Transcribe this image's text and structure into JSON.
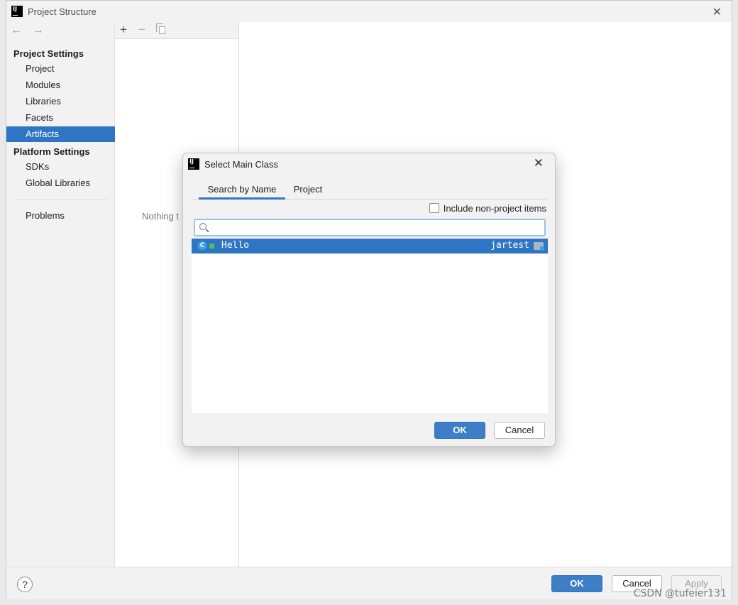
{
  "window": {
    "title": "Project Structure",
    "close_glyph": "✕"
  },
  "nav": {
    "back_glyph": "←",
    "forward_glyph": "→",
    "project_settings_heading": "Project Settings",
    "project_settings_items": [
      "Project",
      "Modules",
      "Libraries",
      "Facets",
      "Artifacts"
    ],
    "platform_settings_heading": "Platform Settings",
    "platform_settings_items": [
      "SDKs",
      "Global Libraries"
    ],
    "problems": "Problems",
    "selected": "Artifacts"
  },
  "toolbar": {
    "add_glyph": "+",
    "remove_glyph": "−"
  },
  "middle": {
    "empty_text": "Nothing t"
  },
  "footer": {
    "help_glyph": "?",
    "ok_label": "OK",
    "cancel_label": "Cancel",
    "apply_label": "Apply"
  },
  "dialog": {
    "title": "Select Main Class",
    "close_glyph": "✕",
    "tabs": [
      "Search by Name",
      "Project"
    ],
    "active_tab": "Search by Name",
    "include_label": "Include non-project items",
    "include_checked": false,
    "search_value": "",
    "results": [
      {
        "icon": "class-icon",
        "icon_letter": "C",
        "name": "Hello",
        "module": "jartest"
      }
    ],
    "ok_label": "OK",
    "cancel_label": "Cancel"
  },
  "watermark": "CSDN @tufeier131",
  "colors": {
    "selection": "#2e75c3",
    "primary_button": "#3c7ec7",
    "panel_bg": "#f2f2f2"
  }
}
